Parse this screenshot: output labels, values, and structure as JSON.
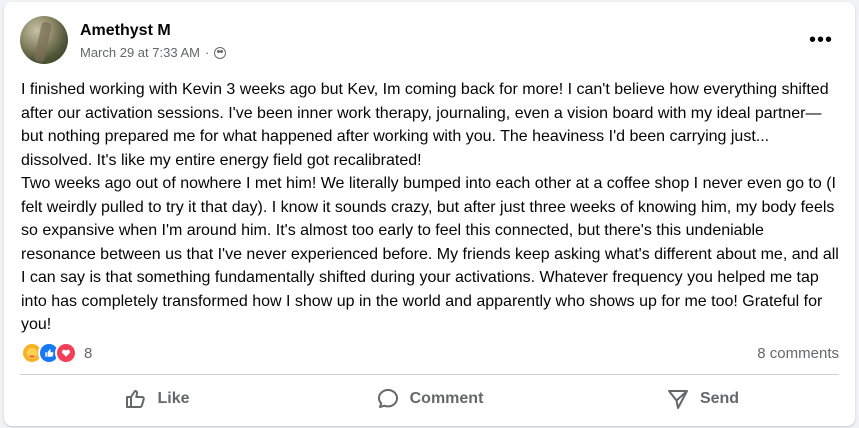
{
  "post": {
    "author": "Amethyst M",
    "timestamp": "March 29 at 7:33 AM",
    "separator": "·",
    "privacy_icon": "friends-icon",
    "more_label": "•••",
    "paragraphs": [
      "I finished working with Kevin 3 weeks ago but Kev, Im coming back for more! I can't believe how everything shifted after our activation sessions. I've been inner work therapy, journaling, even a vision board with my ideal partner—but nothing prepared me for what happened after working with you. The heaviness I'd been carrying just... dissolved. It's like my entire energy field got recalibrated!",
      "Two weeks ago out of nowhere I met him! We literally bumped into each other at a coffee shop I never even go to (I felt weirdly pulled to try it that day). I know it sounds crazy, but after just three weeks of knowing him, my body feels so expansive when I'm around him. It's almost too early to feel this connected, but there's this undeniable resonance between us that I've never experienced before. My friends keep asking what's different about me, and all I can say is that something fundamentally shifted during your activations. Whatever frequency you helped me tap into has completely transformed how I show up in the world and apparently who shows up for me too! Grateful for you!"
    ],
    "reaction_count": "8",
    "comments_label": "8 comments"
  },
  "actions": {
    "like": "Like",
    "comment": "Comment",
    "send": "Send"
  },
  "colors": {
    "like_blue": "#1877f2",
    "love_red": "#f33e58",
    "care_yellow": "#f7b125",
    "secondary_text": "#65676b"
  }
}
